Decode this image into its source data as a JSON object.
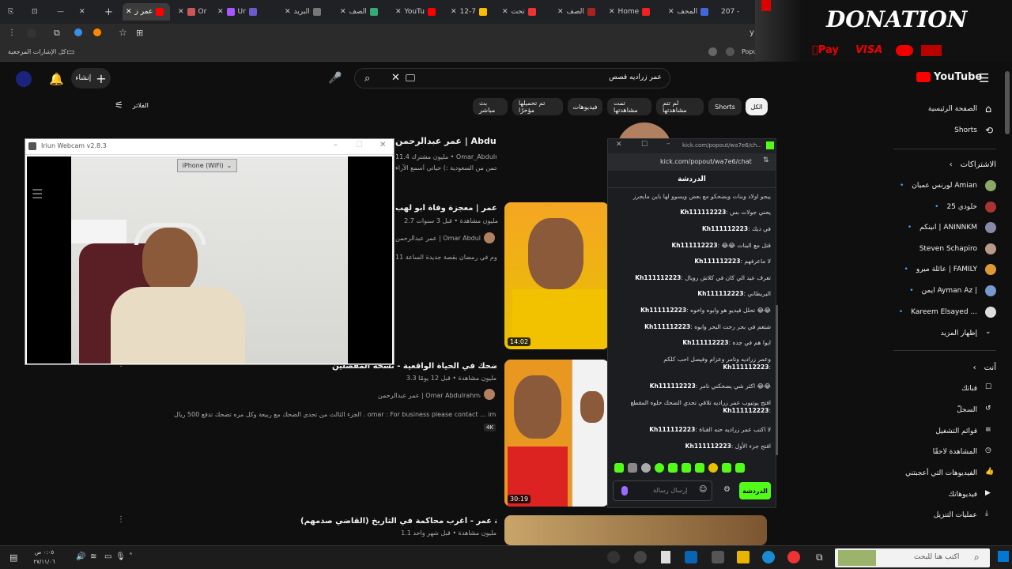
{
  "browser": {
    "tabs": [
      "عمر ز",
      "Or",
      "Ur",
      "البريد",
      "الصف",
      "YouTu",
      "12-7",
      "تحت",
      "الصف",
      "Home",
      "المحف",
      "207 -"
    ],
    "bookmarks_label": "كل الإشارات المرجعية",
    "address_right": "y",
    "popup_label": "Popu"
  },
  "youtube": {
    "logo": "YouTube",
    "search_value": "عمر زراديه قصص",
    "create_label": "إنشاء",
    "filter_label": "الفلاتر",
    "chips": [
      "الكل",
      "Shorts",
      "لم تتم مشاهدتها",
      "تمت مشاهدتها",
      "فيديوهات",
      "تم تحميلها مؤخرًا",
      "بث مباشر"
    ],
    "sidebar": {
      "items": [
        "الصفحة الرئيسية",
        "Shorts"
      ],
      "subs_header": "الاشتراكات",
      "subs": [
        "لورنس عميان Amian",
        "خلودي 25",
        "انينكم | ANINNKM",
        "Steven Schapiro",
        "عائلة ميرو | FAMILY",
        "ايمن Ayman Az |",
        "Kareem Elsayed ..."
      ],
      "show_more": "إظهار المزيد",
      "you_header": "أنت",
      "you_items": [
        "قناتك",
        "السجلّ",
        "قوائم التشغيل",
        "المشاهدة لاحقًا",
        "الفيديوهات التي أعجبتني",
        "فيديوهاتك",
        "عمليات التنزيل"
      ]
    },
    "results": [
      {
        "title": "عمر عبدالرحمن | Abdulrahman",
        "meta": "11.4 مليون مشترك • Omar_Abdulrahman@",
        "desc": "انا عمر عبدالرحمن من السعودية :) حياتي أسمع الآراء"
      },
      {
        "title": "قصص عمر | معجزة وفاة أبو لهب",
        "meta": "2.7 مليون مشاهدة • قبل 3 سنوات",
        "channel": "عمر عبدالرحمن | Omar Abdulrahman",
        "desc": "مايجري كل يوم في رمضان بقصة جديدة الساعة 11",
        "duration": "14:02"
      },
      {
        "title": "تحدي الضحك في الحياة الواقعية - نسخة المفصلين",
        "meta": "3.3 مليون مشاهدة • قبل 12 يومًا",
        "channel": "عمر عبدالرحمن | Omar Abdulrahman",
        "desc": "الجزء الثالث من تحدي الضحك مع ربيعة وكل مره تضحك تدفع 500 ريال . omar : For business please contact ... impression-group.net@",
        "badge": "4K",
        "duration": "30:19"
      },
      {
        "title": "قصة عمر - أغرب محاكمة في التاريخ (القاضي صدمهم)",
        "meta": "1.1 مليون مشاهدة • قبل شهر واحد"
      }
    ]
  },
  "webcam": {
    "title": "Iriun Webcam v2.8.3",
    "device": "iPhone (WiFi)"
  },
  "kick": {
    "url_title": "kick.com/popout/wa7e6/ch...",
    "url": "kick.com/popout/wa7e6/chat",
    "header": "الدردشة",
    "top_msg": "ييجو اولاد وبنات ويضحكو مع بعض ويسوو لها باين مايجرز",
    "messages": [
      {
        "user": "Kh111112223",
        "text": "يحني جولات بس"
      },
      {
        "user": "Kh111112223",
        "text": "في ديك"
      },
      {
        "user": "Kh111112223",
        "text": "قتل مع البنات 😂😂"
      },
      {
        "user": "Kh111112223",
        "text": "لا ماعرفهم"
      },
      {
        "user": "Kh111112223",
        "text": "تعرف عيد الي كان في كلاش رويال"
      },
      {
        "user": "Kh111112223",
        "text": "البريطاني"
      },
      {
        "user": "Kh111112223",
        "text": "😂😂 تحلل فيديو هو وابوه واخوه"
      },
      {
        "user": "Kh111112223",
        "text": "شتعم في بحر رحت البحر وابوه"
      },
      {
        "user": "Kh111112223",
        "text": "ايوا هم في جده"
      },
      {
        "user": "Kh111112223",
        "text": "وعمر زراديه وتامر وعزام وفيصل احب كلكم"
      },
      {
        "user": "Kh111112223",
        "text": "😂😂 اكثر شي يضحكني تامر"
      },
      {
        "user": "Kh111112223",
        "text": "افتح يوتيوب عمر زراديه تلاقي تحدي الضحك حلوه المقطع"
      },
      {
        "user": "Kh111112223",
        "text": "لا اكتب عمر زراديه حنه القناة"
      },
      {
        "user": "Kh111112223",
        "text": "افتح جزء الأول"
      }
    ],
    "input_placeholder": "إرسال رسالة",
    "send_label": "الدردشة"
  },
  "donation": {
    "title": "DONATION",
    "methods": [
      "Pay",
      "VISA"
    ]
  },
  "taskbar": {
    "search_placeholder": "اكتب هنا للبحث",
    "time": "٠:٠٥ ص",
    "date": "٢٧/١١/٠٦"
  }
}
